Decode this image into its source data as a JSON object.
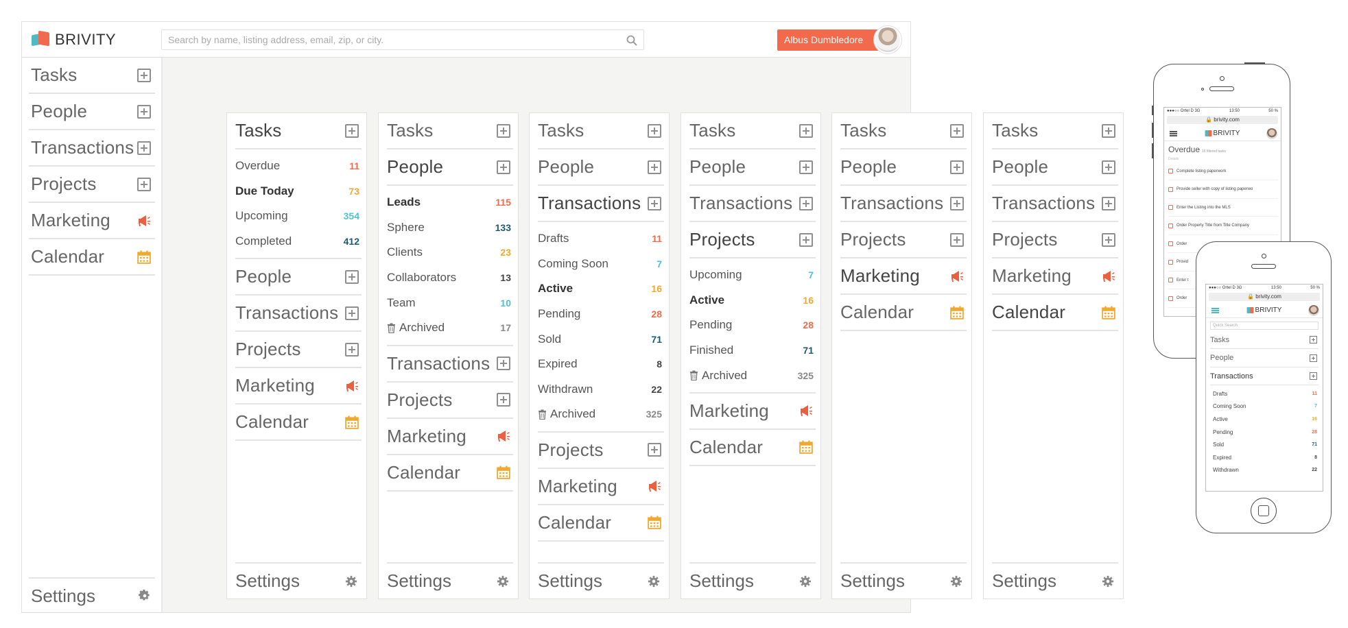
{
  "colors": {
    "orange": "#f26a4b",
    "amber": "#f0a830",
    "teal": "#4fc1d2",
    "navy": "#1e5a6e",
    "gray": "#888888",
    "dark": "#444444"
  },
  "header": {
    "logo_text": "BRIVITY",
    "search_placeholder": "Search by name, listing address, email, zip, or city.",
    "user_name": "Albus Dumbledore"
  },
  "sidebar": {
    "items": [
      {
        "label": "Tasks",
        "icon": "plus-box-icon"
      },
      {
        "label": "People",
        "icon": "plus-box-icon"
      },
      {
        "label": "Transactions",
        "icon": "plus-box-icon"
      },
      {
        "label": "Projects",
        "icon": "plus-box-icon"
      },
      {
        "label": "Marketing",
        "icon": "megaphone-icon"
      },
      {
        "label": "Calendar",
        "icon": "calendar-icon"
      }
    ],
    "settings_label": "Settings"
  },
  "columns": {
    "nav": {
      "tasks": "Tasks",
      "people": "People",
      "transactions": "Transactions",
      "projects": "Projects",
      "marketing": "Marketing",
      "calendar": "Calendar",
      "settings": "Settings"
    },
    "tasks_sub": [
      {
        "label": "Overdue",
        "count": "11",
        "color": "orange",
        "bold": false
      },
      {
        "label": "Due Today",
        "count": "73",
        "color": "amber",
        "bold": true
      },
      {
        "label": "Upcoming",
        "count": "354",
        "color": "teal",
        "bold": false
      },
      {
        "label": "Completed",
        "count": "412",
        "color": "navy",
        "bold": false
      }
    ],
    "people_sub": [
      {
        "label": "Leads",
        "count": "115",
        "color": "orange",
        "bold": true
      },
      {
        "label": "Sphere",
        "count": "133",
        "color": "navy",
        "bold": false
      },
      {
        "label": "Clients",
        "count": "23",
        "color": "amber",
        "bold": false
      },
      {
        "label": "Collaborators",
        "count": "13",
        "color": "dark",
        "bold": false
      },
      {
        "label": "Team",
        "count": "10",
        "color": "teal",
        "bold": false
      },
      {
        "label": "Archived",
        "count": "17",
        "color": "gray",
        "bold": false,
        "trash": true
      }
    ],
    "transactions_sub": [
      {
        "label": "Drafts",
        "count": "11",
        "color": "orange",
        "bold": false
      },
      {
        "label": "Coming Soon",
        "count": "7",
        "color": "teal",
        "bold": false
      },
      {
        "label": "Active",
        "count": "16",
        "color": "amber",
        "bold": true
      },
      {
        "label": "Pending",
        "count": "28",
        "color": "orange",
        "bold": false
      },
      {
        "label": "Sold",
        "count": "71",
        "color": "navy",
        "bold": false
      },
      {
        "label": "Expired",
        "count": "8",
        "color": "dark",
        "bold": false
      },
      {
        "label": "Withdrawn",
        "count": "22",
        "color": "dark",
        "bold": false
      },
      {
        "label": "Archived",
        "count": "325",
        "color": "gray",
        "bold": false,
        "trash": true
      }
    ],
    "projects_sub": [
      {
        "label": "Upcoming",
        "count": "7",
        "color": "teal",
        "bold": false
      },
      {
        "label": "Active",
        "count": "16",
        "color": "amber",
        "bold": true
      },
      {
        "label": "Pending",
        "count": "28",
        "color": "orange",
        "bold": false
      },
      {
        "label": "Finished",
        "count": "71",
        "color": "navy",
        "bold": false
      },
      {
        "label": "Archived",
        "count": "325",
        "color": "gray",
        "bold": false,
        "trash": true
      }
    ]
  },
  "phone1": {
    "status_left": "●●●○○ Ortel D  3G",
    "status_time": "13:50",
    "status_right": "50 %",
    "url": "brivity.com",
    "logo_text": "BRIVITY",
    "title": "Overdue",
    "subtitle": "16 filtered tasks",
    "details_label": "Details",
    "tasks": [
      "Complete listing paperwork",
      "Provide seller with copy of listing paperwo",
      "Enter the Listing into the MLS",
      "Order Property Title from Title Company",
      "Order",
      "Provid",
      "Enter t",
      "Order"
    ]
  },
  "phone2": {
    "status_left": "●●●○○ Ortel D  3G",
    "status_time": "13:50",
    "status_right": "50 %",
    "url": "brivity.com",
    "logo_text": "BRIVITY",
    "search_placeholder": "Quick Search",
    "nav": [
      "Tasks",
      "People",
      "Transactions"
    ],
    "sub": [
      {
        "label": "Drafts",
        "count": "11",
        "color": "orange"
      },
      {
        "label": "Coming Soon",
        "count": "7",
        "color": "teal"
      },
      {
        "label": "Active",
        "count": "16",
        "color": "amber"
      },
      {
        "label": "Pending",
        "count": "28",
        "color": "orange"
      },
      {
        "label": "Sold",
        "count": "71",
        "color": "navy"
      },
      {
        "label": "Expired",
        "count": "8",
        "color": "dark"
      },
      {
        "label": "Withdrawn",
        "count": "22",
        "color": "dark"
      }
    ]
  }
}
